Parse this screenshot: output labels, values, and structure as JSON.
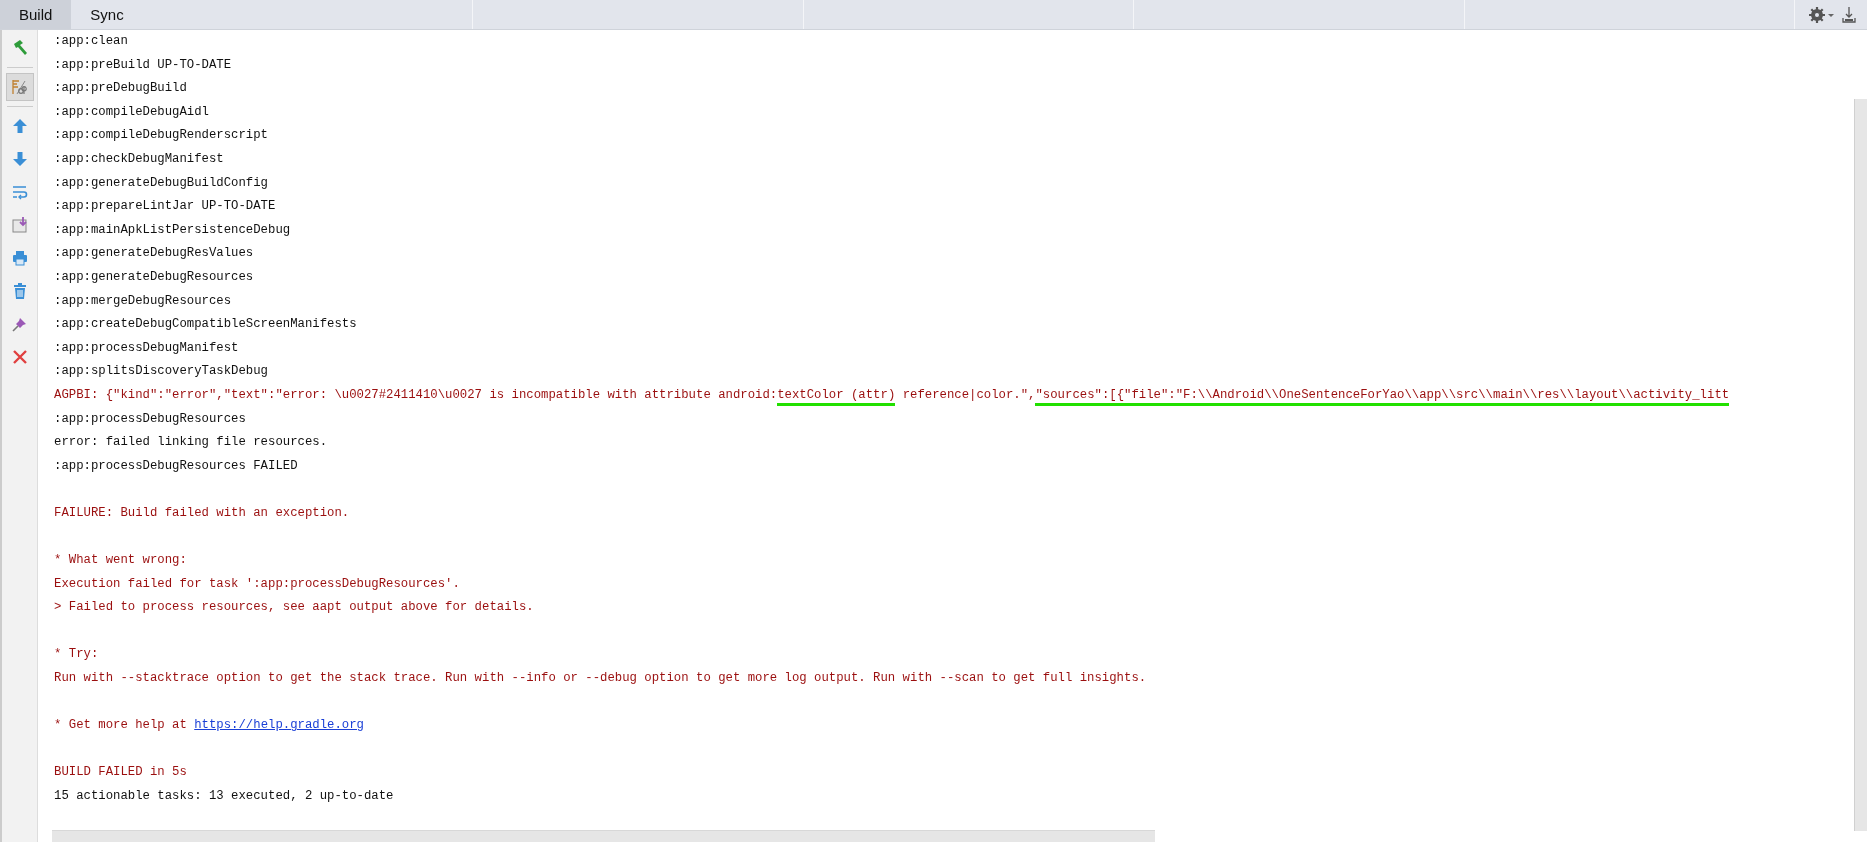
{
  "tabs": [
    {
      "label": "Build",
      "selected": true
    },
    {
      "label": "Sync",
      "selected": false
    }
  ],
  "toolbar": [
    {
      "kind": "hammer",
      "on": false
    },
    {
      "kind": "filter",
      "on": true
    },
    {
      "kind": "up",
      "on": false
    },
    {
      "kind": "down",
      "on": false
    },
    {
      "kind": "wrap",
      "on": false
    },
    {
      "kind": "scroll-end",
      "on": false
    },
    {
      "kind": "print",
      "on": false
    },
    {
      "kind": "trash",
      "on": false
    },
    {
      "kind": "pin",
      "on": false
    },
    {
      "kind": "close",
      "on": false
    }
  ],
  "log": [
    {
      "kind": "normal",
      "space_before": false,
      "segments": [
        {
          "text": ":app:clean",
          "underlined": false
        }
      ]
    },
    {
      "kind": "normal",
      "space_before": false,
      "segments": [
        {
          "text": ":app:preBuild UP-TO-DATE",
          "underlined": false
        }
      ]
    },
    {
      "kind": "normal",
      "space_before": false,
      "segments": [
        {
          "text": ":app:preDebugBuild",
          "underlined": false
        }
      ]
    },
    {
      "kind": "normal",
      "space_before": false,
      "segments": [
        {
          "text": ":app:compileDebugAidl",
          "underlined": false
        }
      ]
    },
    {
      "kind": "normal",
      "space_before": false,
      "segments": [
        {
          "text": ":app:compileDebugRenderscript",
          "underlined": false
        }
      ]
    },
    {
      "kind": "normal",
      "space_before": false,
      "segments": [
        {
          "text": ":app:checkDebugManifest",
          "underlined": false
        }
      ]
    },
    {
      "kind": "normal",
      "space_before": false,
      "segments": [
        {
          "text": ":app:generateDebugBuildConfig",
          "underlined": false
        }
      ]
    },
    {
      "kind": "normal",
      "space_before": false,
      "segments": [
        {
          "text": ":app:prepareLintJar UP-TO-DATE",
          "underlined": false
        }
      ]
    },
    {
      "kind": "normal",
      "space_before": false,
      "segments": [
        {
          "text": ":app:mainApkListPersistenceDebug",
          "underlined": false
        }
      ]
    },
    {
      "kind": "normal",
      "space_before": false,
      "segments": [
        {
          "text": ":app:generateDebugResValues",
          "underlined": false
        }
      ]
    },
    {
      "kind": "normal",
      "space_before": false,
      "segments": [
        {
          "text": ":app:generateDebugResources",
          "underlined": false
        }
      ]
    },
    {
      "kind": "normal",
      "space_before": false,
      "segments": [
        {
          "text": ":app:mergeDebugResources",
          "underlined": false
        }
      ]
    },
    {
      "kind": "normal",
      "space_before": false,
      "segments": [
        {
          "text": ":app:createDebugCompatibleScreenManifests",
          "underlined": false
        }
      ]
    },
    {
      "kind": "normal",
      "space_before": false,
      "segments": [
        {
          "text": ":app:processDebugManifest",
          "underlined": false
        }
      ]
    },
    {
      "kind": "normal",
      "space_before": false,
      "segments": [
        {
          "text": ":app:splitsDiscoveryTaskDebug",
          "underlined": false
        }
      ]
    },
    {
      "kind": "error",
      "space_before": false,
      "segments": [
        {
          "text": "AGPBI: {\"kind\":\"error\",\"text\":\"error: \\u0027#2411410\\u0027 is incompatible with attribute android:",
          "underlined": false
        },
        {
          "text": "textColor (attr)",
          "underlined": true
        },
        {
          "text": " reference|color.\",",
          "underlined": false
        },
        {
          "text": "\"sources\":[{\"file\":\"F:\\\\Android\\\\OneSentenceForYao\\\\app\\\\src\\\\main\\\\res\\\\layout\\\\activity_litt",
          "underlined": true
        }
      ]
    },
    {
      "kind": "normal",
      "space_before": false,
      "segments": [
        {
          "text": ":app:processDebugResources",
          "underlined": false
        }
      ]
    },
    {
      "kind": "normal",
      "space_before": false,
      "segments": [
        {
          "text": "error: failed linking file resources.",
          "underlined": false
        }
      ]
    },
    {
      "kind": "normal",
      "space_before": false,
      "segments": [
        {
          "text": ":app:processDebugResources FAILED",
          "underlined": false
        }
      ]
    },
    {
      "kind": "error",
      "space_before": true,
      "segments": [
        {
          "text": "FAILURE: Build failed with an exception.",
          "underlined": false
        }
      ]
    },
    {
      "kind": "error",
      "space_before": true,
      "segments": [
        {
          "text": "* What went wrong:",
          "underlined": false
        }
      ]
    },
    {
      "kind": "error",
      "space_before": false,
      "segments": [
        {
          "text": "Execution failed for task ':app:processDebugResources'.",
          "underlined": false
        }
      ]
    },
    {
      "kind": "error",
      "space_before": false,
      "segments": [
        {
          "text": "> Failed to process resources, see aapt output above for details.",
          "underlined": false
        }
      ]
    },
    {
      "kind": "error",
      "space_before": true,
      "segments": [
        {
          "text": "* Try:",
          "underlined": false
        }
      ]
    },
    {
      "kind": "error",
      "space_before": false,
      "segments": [
        {
          "text": "Run with --stacktrace option to get the stack trace. Run with --info or --debug option to get more log output. Run with --scan to get full insights.",
          "underlined": false
        }
      ]
    },
    {
      "kind": "error",
      "space_before": true,
      "segments": [
        {
          "text": "* Get more help at ",
          "underlined": false
        }
      ],
      "link": "https://help.gradle.org"
    },
    {
      "kind": "error",
      "space_before": true,
      "segments": [
        {
          "text": "BUILD FAILED in 5s",
          "underlined": false
        }
      ]
    },
    {
      "kind": "normal",
      "space_before": false,
      "segments": [
        {
          "text": "15 actionable tasks: 13 executed, 2 up-to-date",
          "underlined": false
        }
      ]
    }
  ]
}
